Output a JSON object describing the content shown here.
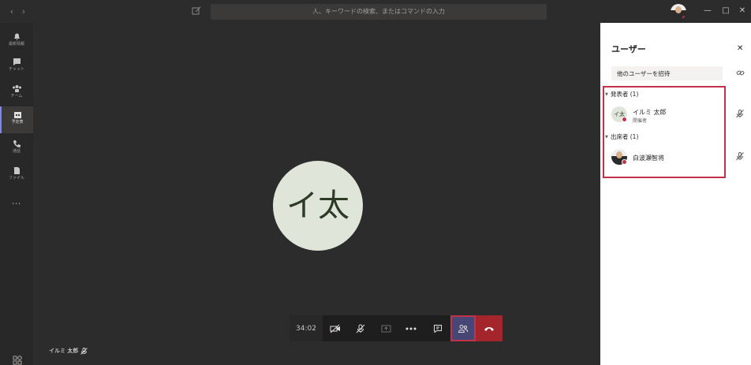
{
  "titlebar": {
    "back_icon": "chevron-left-icon",
    "forward_icon": "chevron-right-icon",
    "compose_icon": "compose-icon",
    "search_placeholder": "人、キーワードの検索、またはコマンドの入力"
  },
  "rail": {
    "items": [
      {
        "icon": "bell-icon",
        "label": "最新情報"
      },
      {
        "icon": "chat-icon",
        "label": "チャット"
      },
      {
        "icon": "teams-icon",
        "label": "チーム"
      },
      {
        "icon": "calendar-icon",
        "label": "予定表",
        "active": true
      },
      {
        "icon": "phone-icon",
        "label": "通話"
      },
      {
        "icon": "file-icon",
        "label": "ファイル"
      }
    ],
    "more": "…"
  },
  "stage": {
    "avatar_initials": "イ太",
    "self_name": "イルミ 太郎"
  },
  "controls": {
    "timer": "34:02",
    "buttons": [
      "video-off-icon",
      "mic-off-icon",
      "share-icon",
      "more-icon",
      "chat-icon",
      "participants-icon",
      "hangup-icon"
    ]
  },
  "panel": {
    "title": "ユーザー",
    "invite_placeholder": "他のユーザーを招待",
    "presenters_label": "発表者 (1)",
    "attendees_label": "出席者 (1)",
    "presenter": {
      "initials": "イ太",
      "name": "イルミ 太郎",
      "role": "開催者"
    },
    "attendee": {
      "name": "白波瀬智将"
    }
  },
  "colors": {
    "accent": "#464775",
    "alert": "#c4314b",
    "hangup": "#a4262c"
  }
}
